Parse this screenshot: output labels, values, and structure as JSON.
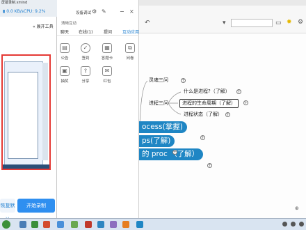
{
  "recorder": {
    "title": "屏幕录制.xmind",
    "network_speed": "0.0 KB/s",
    "cpu": "CPU: 9.2%",
    "tools_label": "展开工具",
    "reset_label": "恢复默认",
    "start_label": "开始录制"
  },
  "meeting": {
    "mode_label": "设备调试",
    "subtitle": "清晰互动",
    "tabs": [
      {
        "label": "聊天",
        "active": false
      },
      {
        "label": "在线(1)",
        "active": false
      },
      {
        "label": "提问",
        "active": false
      },
      {
        "label": "互动应用",
        "active": true
      }
    ],
    "features": [
      {
        "label": "公告",
        "icon": "announcement-icon"
      },
      {
        "label": "签到",
        "icon": "sign-in-icon"
      },
      {
        "label": "答题卡",
        "icon": "answer-card-icon"
      },
      {
        "label": "问卷",
        "icon": "questionnaire-icon"
      },
      {
        "label": "抽奖",
        "icon": "lottery-icon"
      },
      {
        "label": "分享",
        "icon": "share-icon"
      },
      {
        "label": "红包",
        "icon": "red-packet-icon"
      }
    ]
  },
  "mindmap": {
    "topics": {
      "soul": "灵魂三问",
      "process": "进程三问",
      "what": "什么是进程?（了解）",
      "lifecycle": "进程的生命周期（了解）",
      "state": "进程状态（了解）"
    },
    "ribbons": [
      "ocess(掌握)",
      "ps(了解)",
      "的 proc （了解）"
    ]
  },
  "colors": {
    "accent": "#1f86c4",
    "record_border": "#e53935",
    "start_button": "#2f8ff0"
  }
}
